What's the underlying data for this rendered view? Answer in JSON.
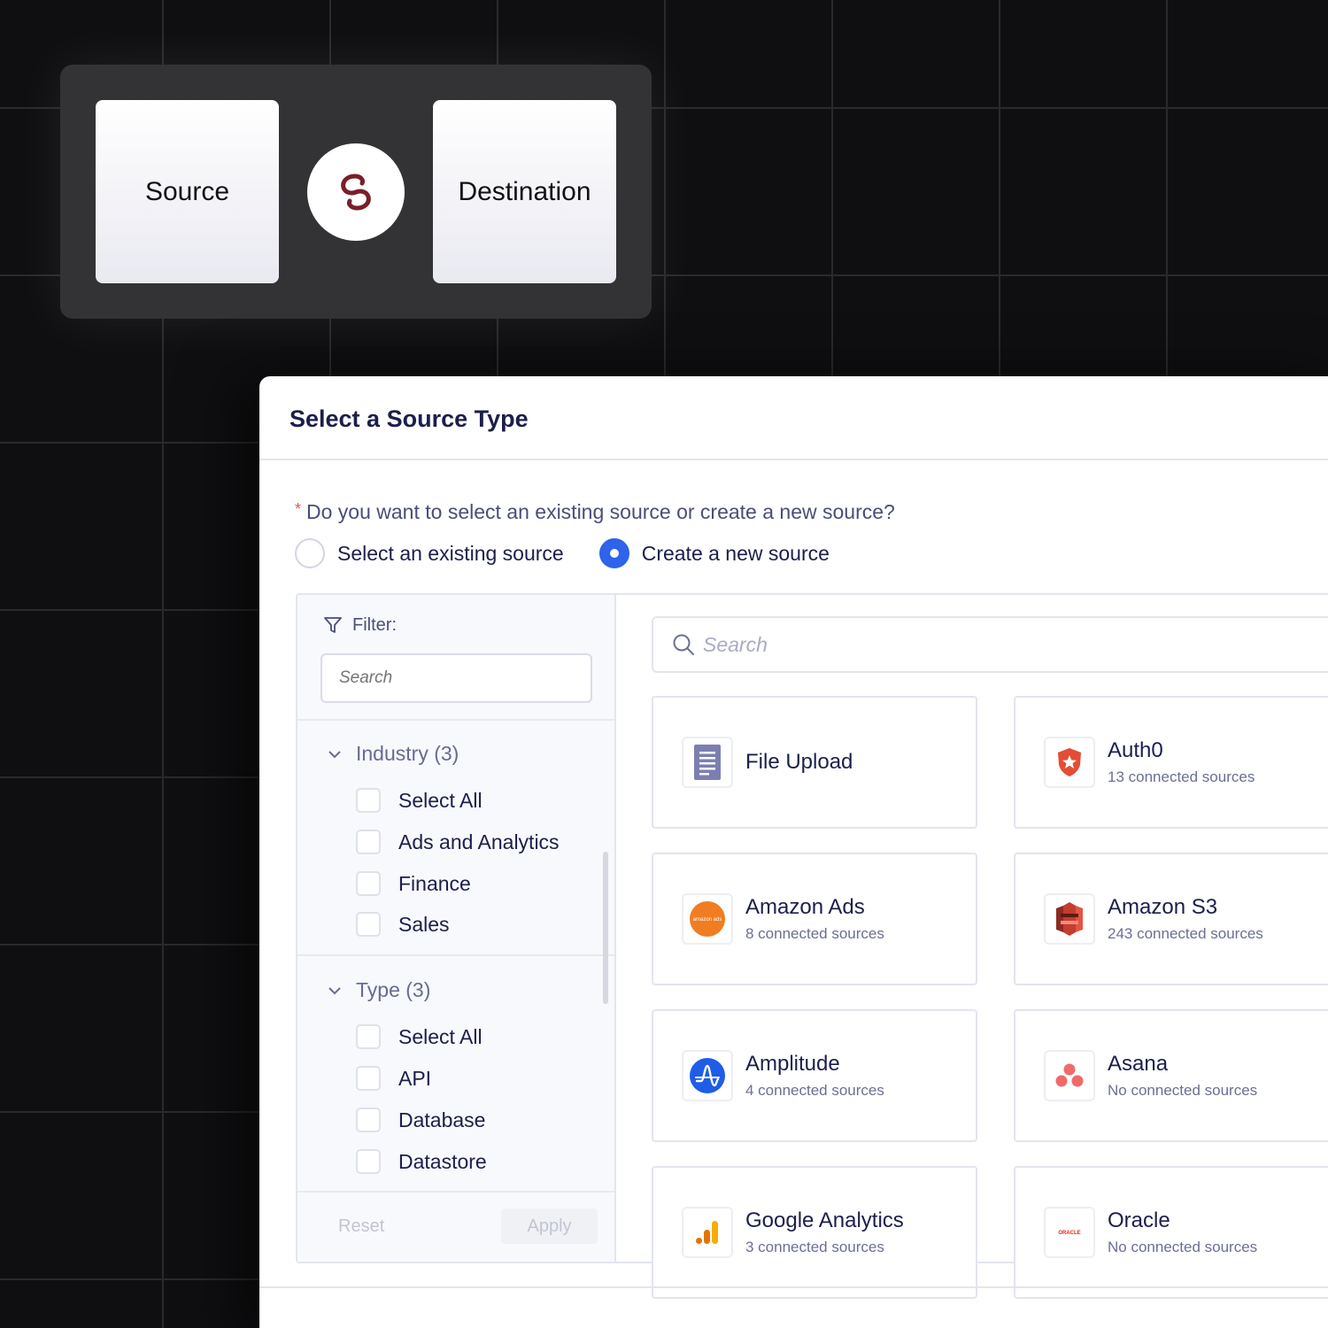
{
  "flow": {
    "source_label": "Source",
    "destination_label": "Destination",
    "link_color": "#7a1f2a"
  },
  "modal": {
    "title": "Select a Source Type",
    "question_required_mark": "*",
    "question": "Do you want to select an existing source or create a new source?",
    "options": [
      {
        "label": "Select an existing source",
        "selected": false
      },
      {
        "label": "Create a new source",
        "selected": true
      }
    ],
    "accent_color": "#2e63ea"
  },
  "filter": {
    "label": "Filter:",
    "search_placeholder": "Search",
    "groups": [
      {
        "title": "Industry (3)",
        "items": [
          "Select All",
          "Ads and Analytics",
          "Finance",
          "Sales"
        ]
      },
      {
        "title": "Type (3)",
        "items": [
          "Select All",
          "API",
          "Database",
          "Datastore"
        ]
      }
    ],
    "reset_label": "Reset",
    "apply_label": "Apply"
  },
  "main": {
    "search_placeholder": "Search",
    "sources": [
      {
        "name": "File Upload",
        "subtitle": "",
        "icon": "document-icon"
      },
      {
        "name": "Auth0",
        "subtitle": "13 connected sources",
        "icon": "auth0-icon"
      },
      {
        "name": "Amazon Ads",
        "subtitle": "8 connected sources",
        "icon": "amazon-ads-icon",
        "icon_text": "amazon ads"
      },
      {
        "name": "Amazon S3",
        "subtitle": "243 connected sources",
        "icon": "amazon-s3-icon"
      },
      {
        "name": "Amplitude",
        "subtitle": "4 connected sources",
        "icon": "amplitude-icon"
      },
      {
        "name": "Asana",
        "subtitle": "No connected sources",
        "icon": "asana-icon"
      },
      {
        "name": "Google Analytics",
        "subtitle": "3 connected sources",
        "icon": "google-analytics-icon"
      },
      {
        "name": "Oracle",
        "subtitle": "No connected sources",
        "icon": "oracle-icon",
        "icon_text": "ORACLE"
      }
    ]
  }
}
